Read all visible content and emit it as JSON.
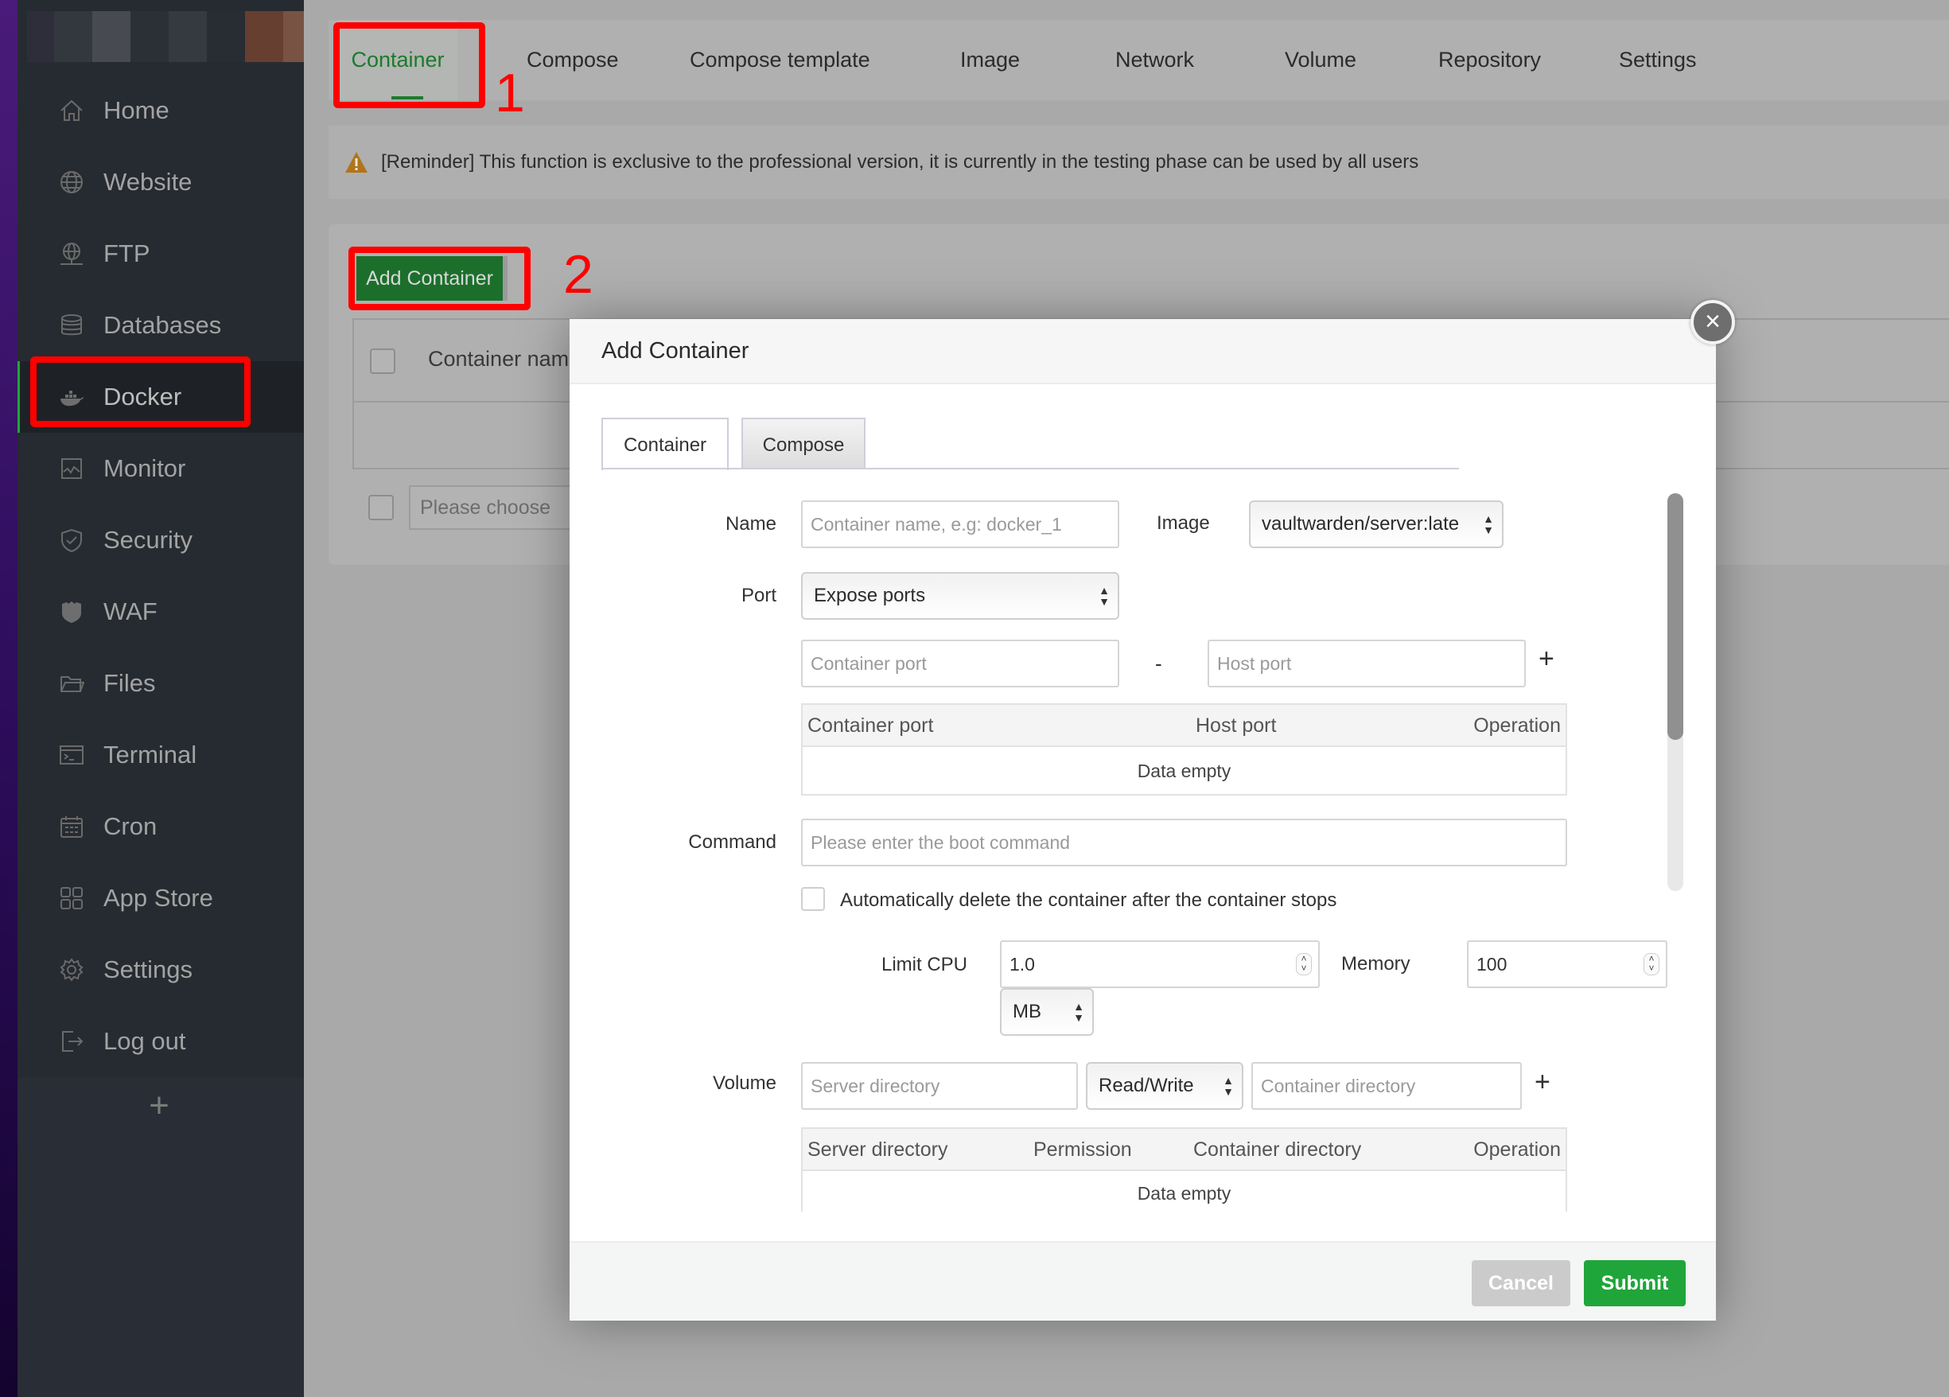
{
  "sidebar": {
    "items": [
      {
        "label": "Home",
        "icon": "home-icon"
      },
      {
        "label": "Website",
        "icon": "globe-icon"
      },
      {
        "label": "FTP",
        "icon": "ftp-icon"
      },
      {
        "label": "Databases",
        "icon": "database-icon"
      },
      {
        "label": "Docker",
        "icon": "docker-icon",
        "active": true
      },
      {
        "label": "Monitor",
        "icon": "monitor-icon"
      },
      {
        "label": "Security",
        "icon": "shield-icon"
      },
      {
        "label": "WAF",
        "icon": "waf-icon"
      },
      {
        "label": "Files",
        "icon": "folder-icon"
      },
      {
        "label": "Terminal",
        "icon": "terminal-icon"
      },
      {
        "label": "Cron",
        "icon": "calendar-icon"
      },
      {
        "label": "App Store",
        "icon": "grid-icon"
      },
      {
        "label": "Settings",
        "icon": "gear-icon"
      },
      {
        "label": "Log out",
        "icon": "logout-icon"
      }
    ],
    "add_label": "+"
  },
  "tabs": {
    "items": [
      "Container",
      "Compose",
      "Compose template",
      "Image",
      "Network",
      "Volume",
      "Repository",
      "Settings"
    ],
    "active": "Container"
  },
  "reminder": {
    "text": "[Reminder] This function is exclusive to the professional version, it is currently in the testing phase can be used by all users"
  },
  "content": {
    "add_button": "Add Container",
    "table_header_first": "Container name",
    "batch_select_placeholder": "Please choose"
  },
  "annotations": {
    "step1": "1",
    "step2": "2"
  },
  "modal": {
    "title": "Add Container",
    "close_label": "×",
    "tabs": [
      "Container",
      "Compose"
    ],
    "active_tab": "Container",
    "name": {
      "label": "Name",
      "placeholder": "Container name, e.g: docker_1",
      "value": ""
    },
    "image": {
      "label": "Image",
      "value": "vaultwarden/server:late"
    },
    "port": {
      "label": "Port",
      "mode": "Expose ports",
      "container_port_placeholder": "Container port",
      "separator": "-",
      "host_port_placeholder": "Host port",
      "add": "+",
      "table_headers": [
        "Container port",
        "Host port",
        "Operation"
      ],
      "empty_text": "Data empty"
    },
    "command": {
      "label": "Command",
      "placeholder": "Please enter the boot command"
    },
    "auto_delete": {
      "label": "Automatically delete the container after the container stops",
      "checked": false
    },
    "limit_cpu": {
      "label": "Limit CPU",
      "value": "1.0"
    },
    "memory": {
      "label": "Memory",
      "value": "100",
      "unit": "MB"
    },
    "volume": {
      "label": "Volume",
      "server_dir_placeholder": "Server directory",
      "permission": "Read/Write",
      "container_dir_placeholder": "Container directory",
      "add": "+",
      "table_headers": [
        "Server directory",
        "Permission",
        "Container directory",
        "Operation"
      ],
      "empty_text": "Data empty"
    },
    "footer": {
      "cancel": "Cancel",
      "submit": "Submit"
    }
  },
  "colors": {
    "brand_green": "#20a53a",
    "active_tab_green": "#1c7a2c",
    "annotation_red": "#ff0000",
    "sidebar_bg": "#262b31"
  }
}
